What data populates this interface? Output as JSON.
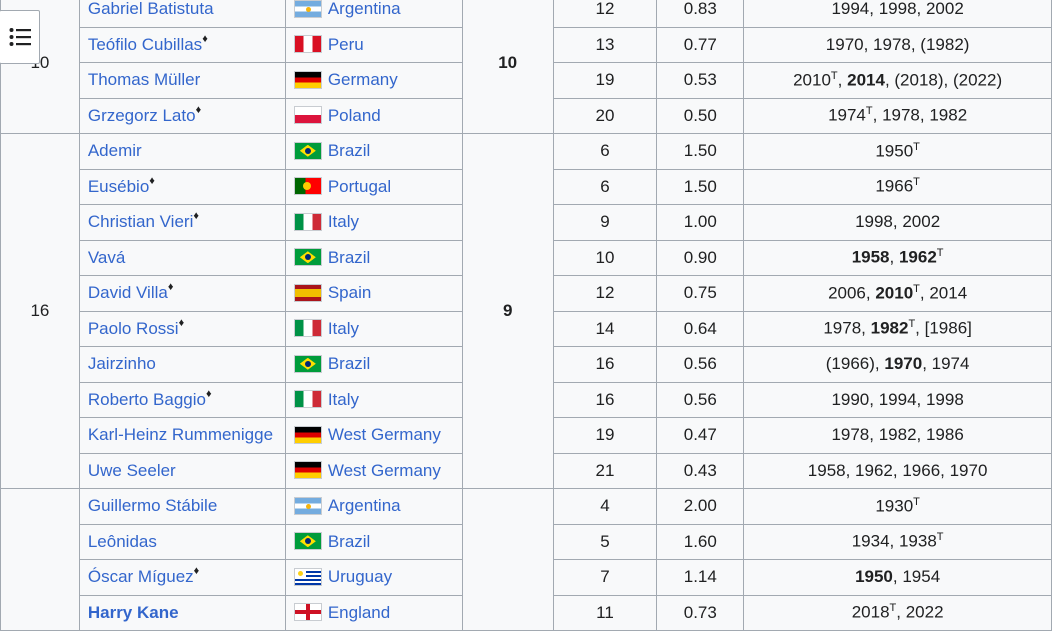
{
  "toc_button": {
    "icon": "list-bullet-icon"
  },
  "groups": [
    {
      "rank": "10",
      "goals": "10",
      "rows": [
        {
          "player": "Gabriel Batistuta",
          "diamond": false,
          "bold": false,
          "flag": "argentina",
          "country": "Argentina",
          "matches": "12",
          "avg": "0.83",
          "years": [
            {
              "t": "1994, 1998, 2002"
            }
          ]
        },
        {
          "player": "Teófilo Cubillas",
          "diamond": true,
          "bold": false,
          "flag": "peru",
          "country": "Peru",
          "matches": "13",
          "avg": "0.77",
          "years": [
            {
              "t": "1970, 1978, (1982)"
            }
          ]
        },
        {
          "player": "Thomas Müller",
          "diamond": false,
          "bold": false,
          "flag": "germany",
          "country": "Germany",
          "matches": "19",
          "avg": "0.53",
          "years": [
            {
              "t": "2010"
            },
            {
              "t": "T",
              "sup": true
            },
            {
              "t": ", "
            },
            {
              "t": "2014",
              "b": true
            },
            {
              "t": ", (2018), (2022)"
            }
          ]
        },
        {
          "player": "Grzegorz Lato",
          "diamond": true,
          "bold": false,
          "flag": "poland",
          "country": "Poland",
          "matches": "20",
          "avg": "0.50",
          "years": [
            {
              "t": "1974"
            },
            {
              "t": "T",
              "sup": true
            },
            {
              "t": ", 1978, 1982"
            }
          ]
        }
      ]
    },
    {
      "rank": "16",
      "goals": "9",
      "rows": [
        {
          "player": "Ademir",
          "diamond": false,
          "bold": false,
          "flag": "brazil",
          "country": "Brazil",
          "matches": "6",
          "avg": "1.50",
          "years": [
            {
              "t": "1950"
            },
            {
              "t": "T",
              "sup": true
            }
          ]
        },
        {
          "player": "Eusébio",
          "diamond": true,
          "bold": false,
          "flag": "portugal",
          "country": "Portugal",
          "matches": "6",
          "avg": "1.50",
          "years": [
            {
              "t": "1966"
            },
            {
              "t": "T",
              "sup": true
            }
          ]
        },
        {
          "player": "Christian Vieri",
          "diamond": true,
          "bold": false,
          "flag": "italy",
          "country": "Italy",
          "matches": "9",
          "avg": "1.00",
          "years": [
            {
              "t": "1998, 2002"
            }
          ]
        },
        {
          "player": "Vavá",
          "diamond": false,
          "bold": false,
          "flag": "brazil",
          "country": "Brazil",
          "matches": "10",
          "avg": "0.90",
          "years": [
            {
              "t": "1958",
              "b": true
            },
            {
              "t": ", "
            },
            {
              "t": "1962",
              "b": true
            },
            {
              "t": "T",
              "sup": true
            }
          ]
        },
        {
          "player": "David Villa",
          "diamond": true,
          "bold": false,
          "flag": "spain",
          "country": "Spain",
          "matches": "12",
          "avg": "0.75",
          "years": [
            {
              "t": "2006, "
            },
            {
              "t": "2010",
              "b": true
            },
            {
              "t": "T",
              "sup": true
            },
            {
              "t": ", 2014"
            }
          ]
        },
        {
          "player": "Paolo Rossi",
          "diamond": true,
          "bold": false,
          "flag": "italy",
          "country": "Italy",
          "matches": "14",
          "avg": "0.64",
          "years": [
            {
              "t": "1978, "
            },
            {
              "t": "1982",
              "b": true
            },
            {
              "t": "T",
              "sup": true
            },
            {
              "t": ", [1986]"
            }
          ]
        },
        {
          "player": "Jairzinho",
          "diamond": false,
          "bold": false,
          "flag": "brazil",
          "country": "Brazil",
          "matches": "16",
          "avg": "0.56",
          "years": [
            {
              "t": "(1966), "
            },
            {
              "t": "1970",
              "b": true
            },
            {
              "t": ", 1974"
            }
          ]
        },
        {
          "player": "Roberto Baggio",
          "diamond": true,
          "bold": false,
          "flag": "italy",
          "country": "Italy",
          "matches": "16",
          "avg": "0.56",
          "years": [
            {
              "t": "1990, 1994, 1998"
            }
          ]
        },
        {
          "player": "Karl-Heinz Rummenigge",
          "diamond": false,
          "bold": false,
          "flag": "germany",
          "country": "West Germany",
          "matches": "19",
          "avg": "0.47",
          "years": [
            {
              "t": "1978, 1982, 1986"
            }
          ]
        },
        {
          "player": "Uwe Seeler",
          "diamond": false,
          "bold": false,
          "flag": "germany",
          "country": "West Germany",
          "matches": "21",
          "avg": "0.43",
          "years": [
            {
              "t": "1958, 1962, 1966, 1970"
            }
          ]
        }
      ]
    },
    {
      "rank": "",
      "goals": "",
      "rows": [
        {
          "player": "Guillermo Stábile",
          "diamond": false,
          "bold": false,
          "flag": "argentina",
          "country": "Argentina",
          "matches": "4",
          "avg": "2.00",
          "years": [
            {
              "t": "1930"
            },
            {
              "t": "T",
              "sup": true
            }
          ]
        },
        {
          "player": "Leônidas",
          "diamond": false,
          "bold": false,
          "flag": "brazil",
          "country": "Brazil",
          "matches": "5",
          "avg": "1.60",
          "years": [
            {
              "t": "1934, 1938"
            },
            {
              "t": "T",
              "sup": true
            }
          ]
        },
        {
          "player": "Óscar Míguez",
          "diamond": true,
          "bold": false,
          "flag": "uruguay",
          "country": "Uruguay",
          "matches": "7",
          "avg": "1.14",
          "years": [
            {
              "t": "1950",
              "b": true
            },
            {
              "t": ", 1954"
            }
          ]
        },
        {
          "player": "Harry Kane",
          "diamond": false,
          "bold": true,
          "flag": "england",
          "country": "England",
          "matches": "11",
          "avg": "0.73",
          "years": [
            {
              "t": "2018"
            },
            {
              "t": "T",
              "sup": true
            },
            {
              "t": ", 2022"
            }
          ]
        }
      ]
    }
  ]
}
